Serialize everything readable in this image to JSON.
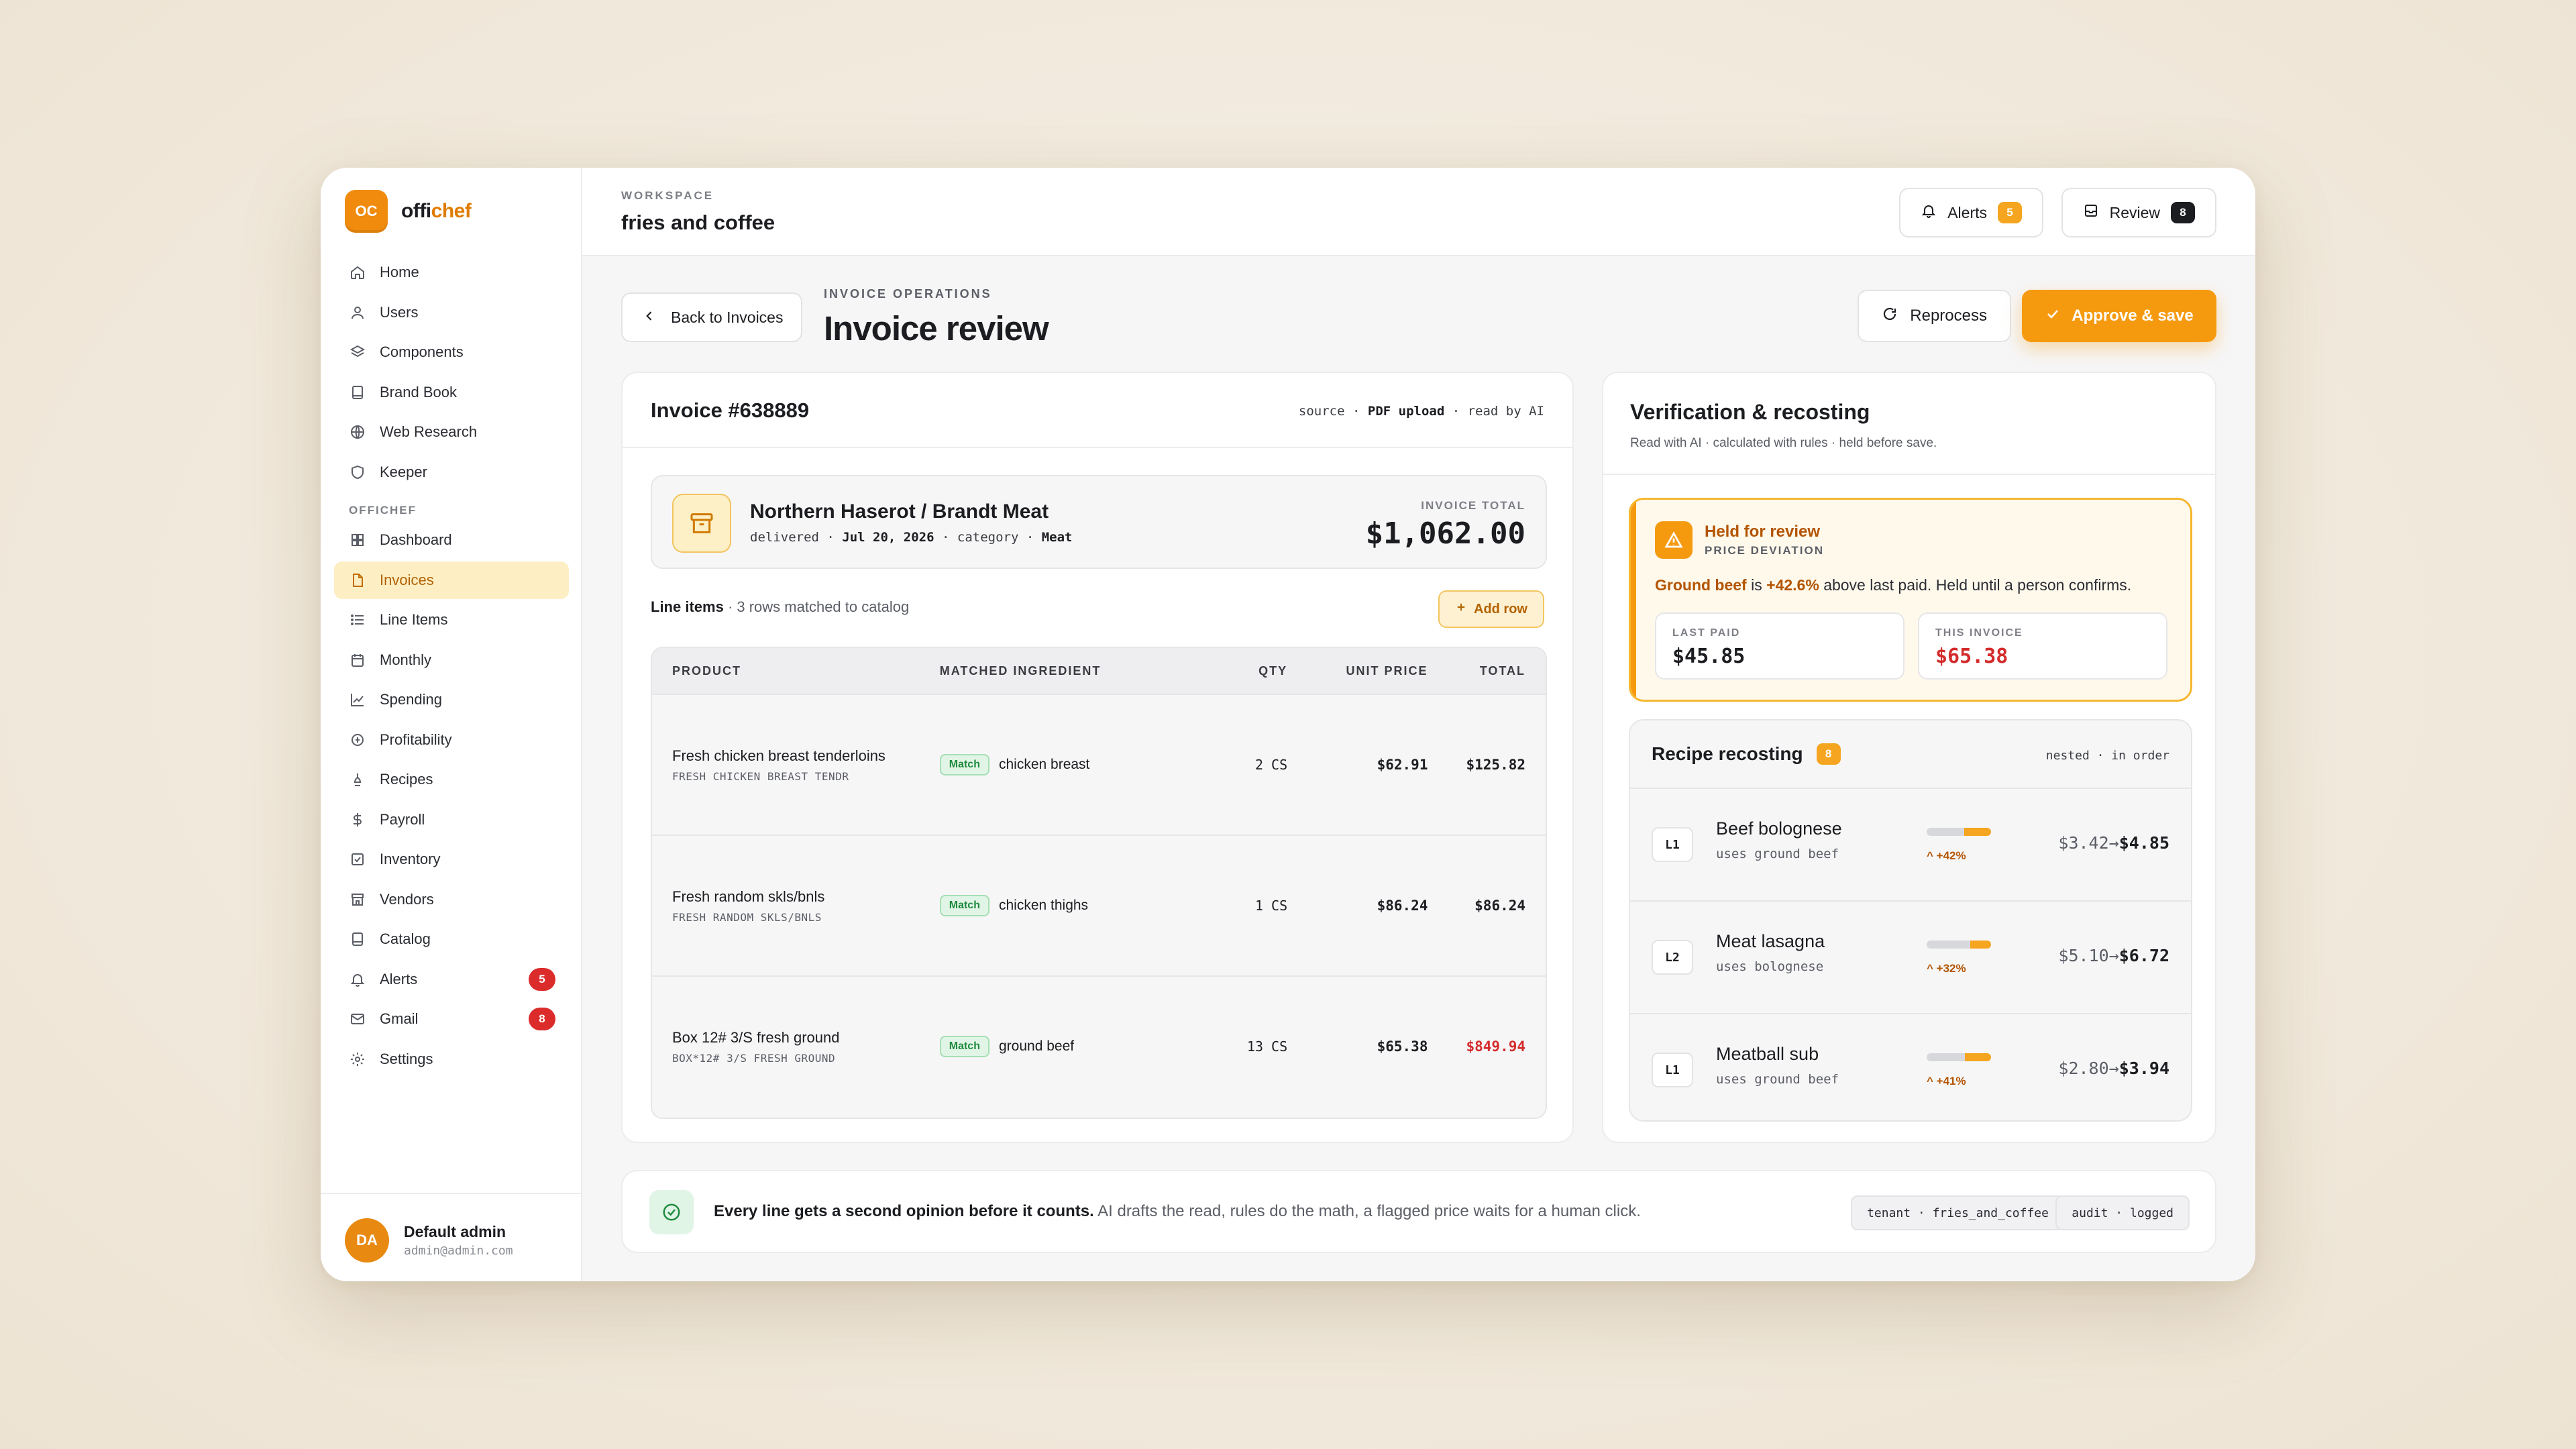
{
  "app": {
    "logo_mark": "OC",
    "name_part1": "offi",
    "name_part2": "chef"
  },
  "sidebar": {
    "items": [
      {
        "label": "Home",
        "icon": "home-icon"
      },
      {
        "label": "Users",
        "icon": "user-icon"
      },
      {
        "label": "Components",
        "icon": "layers-icon"
      },
      {
        "label": "Brand Book",
        "icon": "book-icon"
      },
      {
        "label": "Web Research",
        "icon": "globe-icon"
      },
      {
        "label": "Keeper",
        "icon": "shield-icon"
      }
    ],
    "section_label": "OFFICHEF",
    "section_items": [
      {
        "label": "Dashboard",
        "icon": "grid-icon"
      },
      {
        "label": "Invoices",
        "icon": "file-icon",
        "active": true
      },
      {
        "label": "Line Items",
        "icon": "list-icon"
      },
      {
        "label": "Monthly",
        "icon": "calendar-icon"
      },
      {
        "label": "Spending",
        "icon": "chart-line-icon"
      },
      {
        "label": "Profitability",
        "icon": "coins-icon"
      },
      {
        "label": "Recipes",
        "icon": "chef-hat-icon"
      },
      {
        "label": "Payroll",
        "icon": "dollar-icon"
      },
      {
        "label": "Inventory",
        "icon": "box-check-icon"
      },
      {
        "label": "Vendors",
        "icon": "store-icon"
      },
      {
        "label": "Catalog",
        "icon": "catalog-icon"
      },
      {
        "label": "Alerts",
        "icon": "bell-icon",
        "badge": "5"
      },
      {
        "label": "Gmail",
        "icon": "mail-icon",
        "badge": "8"
      },
      {
        "label": "Settings",
        "icon": "gear-icon"
      }
    ],
    "user": {
      "initials": "DA",
      "name": "Default admin",
      "email": "admin@admin.com"
    }
  },
  "topbar": {
    "workspace_label": "WORKSPACE",
    "workspace_name": "fries and coffee",
    "alerts_label": "Alerts",
    "alerts_count": "5",
    "review_label": "Review",
    "review_count": "8"
  },
  "page": {
    "back_label": "Back to Invoices",
    "kicker": "INVOICE OPERATIONS",
    "title": "Invoice review",
    "reprocess_label": "Reprocess",
    "approve_label": "Approve & save"
  },
  "invoice": {
    "number": "Invoice #638889",
    "source_label": "source",
    "source_value": "PDF upload",
    "read_by": "read by AI",
    "vendor": "Northern Haserot / Brandt Meat",
    "delivered_label": "delivered",
    "delivered_date": "Jul 20, 2026",
    "category_label": "category",
    "category_value": "Meat",
    "total_label": "INVOICE TOTAL",
    "total_value": "$1,062.00",
    "line_items_label": "Line items",
    "line_items_note": "· 3 rows matched to catalog",
    "add_row_label": "Add row",
    "columns": [
      "PRODUCT",
      "MATCHED INGREDIENT",
      "QTY",
      "UNIT PRICE",
      "TOTAL"
    ],
    "rows": [
      {
        "product": "Fresh chicken breast tenderloins",
        "code": "FRESH CHICKEN BREAST TENDR",
        "match": "Match",
        "ingredient": "chicken breast",
        "qty": "2 CS",
        "unit": "$62.91",
        "total": "$125.82",
        "flag": false
      },
      {
        "product": "Fresh random skls/bnls",
        "code": "FRESH RANDOM SKLS/BNLS",
        "match": "Match",
        "ingredient": "chicken thighs",
        "qty": "1 CS",
        "unit": "$86.24",
        "total": "$86.24",
        "flag": false
      },
      {
        "product": "Box 12# 3/S fresh ground",
        "code": "BOX*12# 3/S FRESH GROUND",
        "match": "Match",
        "ingredient": "ground beef",
        "qty": "13 CS",
        "unit": "$65.38",
        "total": "$849.94",
        "flag": true
      }
    ]
  },
  "verification": {
    "title": "Verification & recosting",
    "subtitle": "Read with AI · calculated with rules · held before save.",
    "held_title": "Held for review",
    "held_kicker": "PRICE DEVIATION",
    "held_item": "Ground beef",
    "held_is": "is",
    "held_pct": "+42.6%",
    "held_rest": "above last paid. Held until a person confirms.",
    "last_paid_label": "LAST PAID",
    "last_paid_value": "$45.85",
    "this_invoice_label": "THIS INVOICE",
    "this_invoice_value": "$65.38",
    "recosting_title": "Recipe recosting",
    "recosting_count": "8",
    "recosting_meta": "nested · in order",
    "recipes": [
      {
        "level": "L1",
        "name": "Beef bolognese",
        "uses": "uses ground beef",
        "pct_label": "+42%",
        "increase": 0.42,
        "old": "$3.42",
        "new": "$4.85"
      },
      {
        "level": "L2",
        "name": "Meat lasagna",
        "uses": "uses bolognese",
        "pct_label": "+32%",
        "increase": 0.32,
        "old": "$5.10",
        "new": "$6.72"
      },
      {
        "level": "L1",
        "name": "Meatball sub",
        "uses": "uses ground beef",
        "pct_label": "+41%",
        "increase": 0.41,
        "old": "$2.80",
        "new": "$3.94"
      }
    ]
  },
  "footer": {
    "bold": "Every line gets a second opinion before it counts.",
    "text": "AI drafts the read, rules do the math, a flagged price waits for a human click.",
    "tag1": "tenant · fries_and_coffee",
    "tag2": "audit · logged"
  },
  "colors": {
    "accent": "#f59a0f",
    "danger": "#d42b2b",
    "success": "#1f8a3e",
    "warning_text": "#b35400"
  }
}
